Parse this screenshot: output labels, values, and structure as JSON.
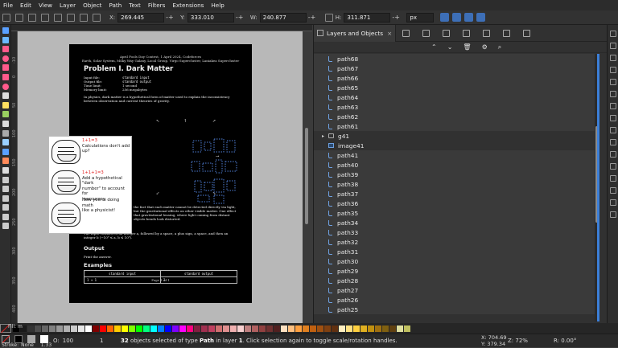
{
  "menu": [
    "File",
    "Edit",
    "View",
    "Layer",
    "Object",
    "Path",
    "Text",
    "Filters",
    "Extensions",
    "Help"
  ],
  "toolctl": {
    "x_label": "X:",
    "x_value": "269.445",
    "y_label": "Y:",
    "y_value": "333.010",
    "w_label": "W:",
    "w_value": "240.877",
    "h_label": "H:",
    "h_value": "311.871",
    "unit": "px"
  },
  "ruler_v": [
    "-10",
    "0",
    "50",
    "100",
    "150",
    "200",
    "250",
    "300",
    "350",
    "400",
    "450"
  ],
  "page": {
    "header_line1": "April Fools Day Contest, 1 April 2024, Codeforces",
    "header_line2": "Earth, Solar System, Milky Way Galaxy, Local Group, Virgo Supercluster, Laniakea Supercluster",
    "title": "Problem I. Dark Matter",
    "meta": [
      {
        "k": "Input file:",
        "v": "standard input"
      },
      {
        "k": "Output file:",
        "v": "standard output"
      },
      {
        "k": "Time limit:",
        "v": "1 second"
      },
      {
        "k": "Memory limit:",
        "v": "256 megabytes"
      }
    ],
    "intro": "In physics, dark matter is a hypothetical form of matter used to explain the inconsistency between observation and current theories of gravity.",
    "middle": "the fact that each matter cannot be detected directly via light, but the gravitational effects on other visible matter. One effect that gravitational lensing, where light coming from distant objects bends look distorted.",
    "input_text": "The input consists of an integer a, followed by a space, a plus sign, a space, and then an integer b (−10⁹ ≤ a, b ≤ 10⁹).",
    "output_heading": "Output",
    "output_text": "Print the answer.",
    "examples_heading": "Examples",
    "ex_head_in": "standard input",
    "ex_head_out": "standard output",
    "ex_in": "1 + 1",
    "ex_out": "3",
    "footer": "Page 1 of 1"
  },
  "comic": {
    "eq1": "1+1=3",
    "t1": "Calculations don't add up?",
    "eq2": "1+1+1=3",
    "t2a": "Add a hypothetical \"dark",
    "t2b": "number\" to account for",
    "t2c": "inaccuracy.",
    "t3a": "Now you're doing math",
    "t3b": "like a physicist!"
  },
  "panel": {
    "tab_title": "Layers and Objects",
    "tab_close": "×",
    "rows": [
      {
        "label": "path68",
        "type": "path",
        "sel": true
      },
      {
        "label": "path67",
        "type": "path",
        "sel": true
      },
      {
        "label": "path66",
        "type": "path",
        "sel": true
      },
      {
        "label": "path65",
        "type": "path",
        "sel": true
      },
      {
        "label": "path64",
        "type": "path",
        "sel": true
      },
      {
        "label": "path63",
        "type": "path",
        "sel": true
      },
      {
        "label": "path62",
        "type": "path",
        "sel": true
      },
      {
        "label": "path61",
        "type": "path",
        "sel": true
      },
      {
        "label": "g41",
        "type": "group",
        "sel": false
      },
      {
        "label": "image41",
        "type": "image",
        "sel": false
      },
      {
        "label": "path41",
        "type": "path",
        "sel": true
      },
      {
        "label": "path40",
        "type": "path",
        "sel": true
      },
      {
        "label": "path39",
        "type": "path",
        "sel": true
      },
      {
        "label": "path38",
        "type": "path",
        "sel": true
      },
      {
        "label": "path37",
        "type": "path",
        "sel": true
      },
      {
        "label": "path36",
        "type": "path",
        "sel": true
      },
      {
        "label": "path35",
        "type": "path",
        "sel": true
      },
      {
        "label": "path34",
        "type": "path",
        "sel": true
      },
      {
        "label": "path33",
        "type": "path",
        "sel": true
      },
      {
        "label": "path32",
        "type": "path",
        "sel": true
      },
      {
        "label": "path31",
        "type": "path",
        "sel": true
      },
      {
        "label": "path30",
        "type": "path",
        "sel": true
      },
      {
        "label": "path29",
        "type": "path",
        "sel": true
      },
      {
        "label": "path28",
        "type": "path",
        "sel": true
      },
      {
        "label": "path27",
        "type": "path",
        "sel": true
      },
      {
        "label": "path26",
        "type": "path",
        "sel": true
      },
      {
        "label": "path25",
        "type": "path",
        "sel": true
      }
    ]
  },
  "palette": [
    "#000000",
    "#1a1a1a",
    "#333333",
    "#4d4d4d",
    "#666666",
    "#808080",
    "#999999",
    "#b3b3b3",
    "#cccccc",
    "#e6e6e6",
    "#ffffff",
    "#800000",
    "#ff0000",
    "#ff6600",
    "#ffcc00",
    "#ffff00",
    "#80ff00",
    "#00ff00",
    "#00ff80",
    "#00ffff",
    "#0080ff",
    "#0000ff",
    "#8000ff",
    "#ff00ff",
    "#ff0080",
    "#802040",
    "#a03050",
    "#c04060",
    "#d07070",
    "#e09090",
    "#f0b0b0",
    "#f8d0d0",
    "#c08080",
    "#b06060",
    "#904040",
    "#703030",
    "#502020",
    "#ffe0c0",
    "#ffc080",
    "#ffa040",
    "#e08020",
    "#c06010",
    "#a05010",
    "#804010",
    "#603010",
    "#ffeec0",
    "#ffe080",
    "#ffd040",
    "#e0b020",
    "#c09010",
    "#a07010",
    "#806010",
    "#604010",
    "#e0e0a0",
    "#c0c060"
  ],
  "status": {
    "fill_label": "Fill:",
    "fill_value": "m",
    "stroke_label": "Stroke:",
    "stroke_value": "None",
    "stroke_width": "1.33",
    "opacity_label": "O:",
    "opacity_value": "100",
    "layer_value": "1",
    "msg_count": "32",
    "msg_pre": "objects selected of type",
    "msg_type": "Path",
    "msg_mid": "in layer",
    "msg_layer": "1",
    "msg_post": ". Click selection again to toggle scale/rotation handles.",
    "x_label": "X:",
    "x_value": "704.69",
    "y_label": "Y:",
    "y_value": "379.34",
    "zoom_label": "Z:",
    "zoom_value": "72%",
    "rot_label": "R:",
    "rot_value": "0.00°"
  }
}
